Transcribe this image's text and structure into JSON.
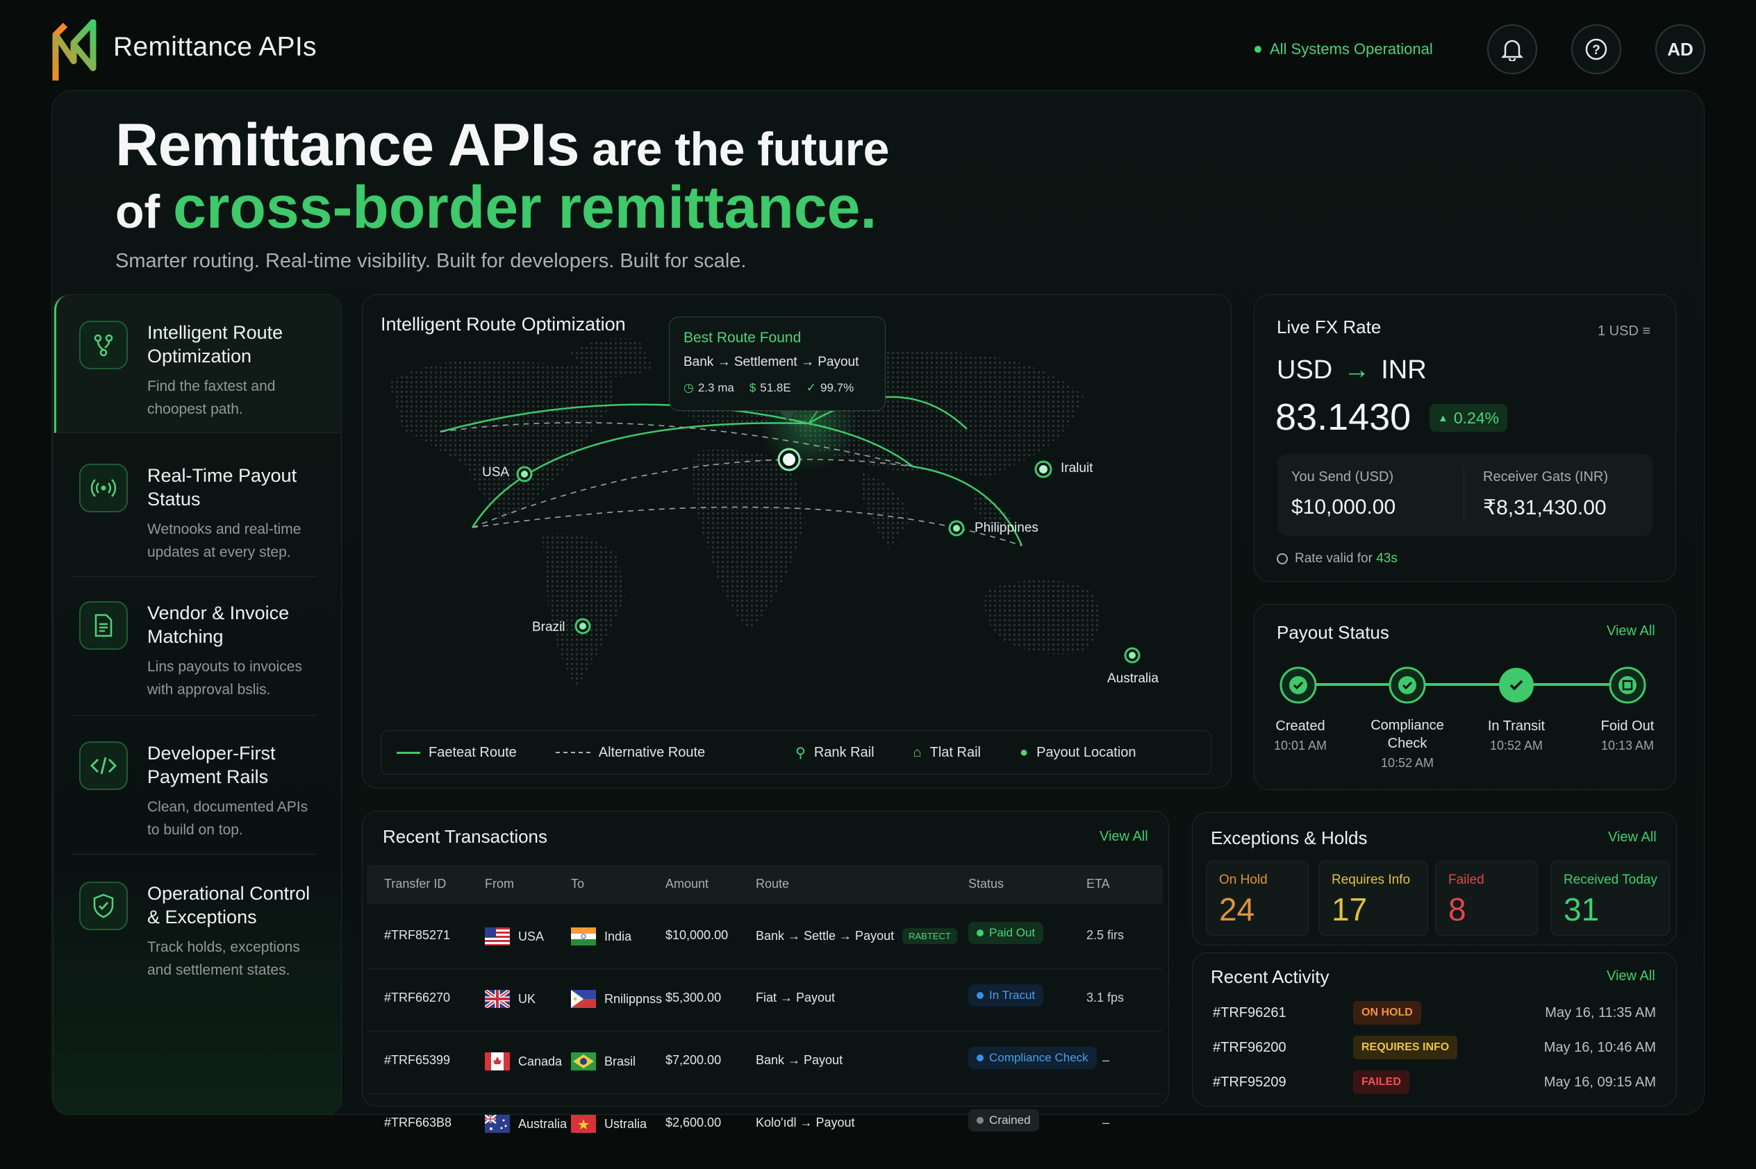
{
  "header": {
    "app_name": "Remittance APIs",
    "system_status": "All Systems Operational",
    "avatar_initials": "AD"
  },
  "hero": {
    "line1_bold": "Remittance APIs",
    "line1_rest": " are the future",
    "line2_prefix": "of ",
    "line2_highlight": "cross-border remittance.",
    "subtitle": "Smarter routing. Real-time visibility. Built for developers. Built for scale."
  },
  "features": [
    {
      "title": "Intelligent Route Optimization",
      "desc": "Find the faxtest and choopest path.",
      "icon": "route-icon"
    },
    {
      "title": "Real-Time Payout Status",
      "desc": "Wetnooks and real-time updates at every step.",
      "icon": "broadcast-icon"
    },
    {
      "title": "Vendor & Invoice Matching",
      "desc": "Lins payouts to invoices with approval bslis.",
      "icon": "document-icon"
    },
    {
      "title": "Developer-First Payment Rails",
      "desc": "Clean, documented APIs to build on top.",
      "icon": "code-icon"
    },
    {
      "title": "Operational Control & Exceptions",
      "desc": "Track holds, exceptions and settlement states.",
      "icon": "shield-check-icon"
    }
  ],
  "map": {
    "title": "Intelligent Route Optimization",
    "tooltip": {
      "heading": "Best Route Found",
      "route": "Bank → Settlement → Payout",
      "time": "2.3 ma",
      "cost": "51.8E",
      "success": "99.7%"
    },
    "cities": {
      "usa": "USA",
      "iran": "Iraluit",
      "philippines": "Philippines",
      "brazil": "Brazil",
      "australia": "Australia"
    },
    "legend": {
      "fastest": "Faeteat Route",
      "alternative": "Alternative Route",
      "rank_rail": "Rank Rail",
      "tlat_rail": "Tlat Rail",
      "payout_location": "Payout Location"
    }
  },
  "fx": {
    "title": "Live FX Rate",
    "unit": "1 USD ≡",
    "from": "USD",
    "to": "INR",
    "rate": "83.1430",
    "change": "0.24%",
    "send_label": "You Send (USD)",
    "send_value": "$10,000.00",
    "receive_label": "Receiver Gats (INR)",
    "receive_value": "₹8,31,430.00",
    "valid_prefix": "Rate valid for ",
    "valid_time": "43s"
  },
  "payout": {
    "title": "Payout Status",
    "view_all": "View All",
    "steps": [
      {
        "label": "Created",
        "time": "10:01 AM"
      },
      {
        "label": "Compliance Check",
        "time": "10:52 AM"
      },
      {
        "label": "In Transit",
        "time": "10:52 AM"
      },
      {
        "label": "Foid Out",
        "time": "10:13 AM"
      }
    ]
  },
  "transactions": {
    "title": "Recent Transactions",
    "view_all": "View All",
    "columns": [
      "Transfer ID",
      "From",
      "To",
      "Amount",
      "Route",
      "Status",
      "ETA"
    ],
    "rows": [
      {
        "id": "#TRF85271",
        "from": "USA",
        "from_flag": "us-flag",
        "to": "India",
        "to_flag": "in-flag",
        "amount": "$10,000.00",
        "route": "Bank → Settle → Payout",
        "route_tag": "RABTECT",
        "status": "Paid Out",
        "status_kind": "paid",
        "eta": "2.5 firs"
      },
      {
        "id": "#TRF66270",
        "from": "UK",
        "from_flag": "uk-flag",
        "to": "Rnilippnss",
        "to_flag": "ph-flag",
        "amount": "$5,300.00",
        "route": "Fiat → Payout",
        "route_tag": "",
        "status": "In Tracut",
        "status_kind": "transit",
        "eta": "3.1 fps"
      },
      {
        "id": "#TRF65399",
        "from": "Canada",
        "from_flag": "ca-flag",
        "to": "Brasil",
        "to_flag": "br-flag",
        "amount": "$7,200.00",
        "route": "Bank → Payout",
        "route_tag": "",
        "status": "Compliance Check",
        "status_kind": "compliance",
        "eta": "–"
      },
      {
        "id": "#TRF663B8",
        "from": "Australia",
        "from_flag": "au-flag",
        "to": "Ustralia",
        "to_flag": "vn-flag",
        "amount": "$2,600.00",
        "route": "Kolo'ıdl → Payout",
        "route_tag": "",
        "status": "Crained",
        "status_kind": "gray",
        "eta": "–"
      }
    ]
  },
  "exceptions": {
    "title": "Exceptions & Holds",
    "view_all": "View All",
    "cards": [
      {
        "label": "On Hold",
        "value": "24",
        "color": "#e2913a"
      },
      {
        "label": "Requires Info",
        "value": "17",
        "color": "#e3c13c"
      },
      {
        "label": "Failed",
        "value": "8",
        "color": "#e2474a"
      },
      {
        "label": "Received Today",
        "value": "31",
        "color": "#3fcf6f"
      }
    ]
  },
  "activity": {
    "title": "Recent Activity",
    "view_all": "View All",
    "items": [
      {
        "id": "#TRF96261",
        "status": "ON HOLD",
        "kind": "hold",
        "time": "May 16, 11:35 AM"
      },
      {
        "id": "#TRF96200",
        "status": "REQUIRES INFO",
        "kind": "info",
        "time": "May 16, 10:46 AM"
      },
      {
        "id": "#TRF95209",
        "status": "FAILED",
        "kind": "failed",
        "time": "May 16, 09:15 AM"
      }
    ]
  },
  "colors": {
    "accent": "#3ec96a",
    "background": "#080d0c",
    "panel": "#0c1413"
  }
}
